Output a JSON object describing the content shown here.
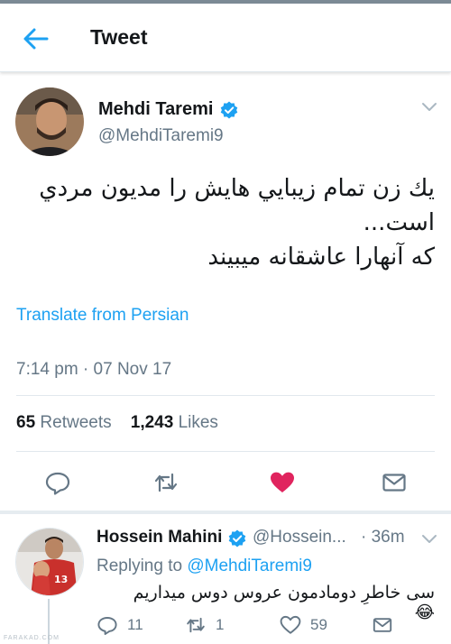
{
  "header": {
    "title": "Tweet",
    "back_icon": "arrow-left-icon"
  },
  "tweet": {
    "author_name": "Mehdi Taremi",
    "handle": "@MehdiTaremi9",
    "text_lines": [
      "يك زن تمام زيبايي هايش را مديون مردي",
      "است...",
      "كه آنهارا عاشقانه ميبيند"
    ],
    "translate_label": "Translate from Persian",
    "timestamp": "7:14 pm · 07 Nov 17",
    "retweets_count": "65",
    "retweets_label": "Retweets",
    "likes_count": "1,243",
    "likes_label": "Likes",
    "liked": true
  },
  "reply": {
    "author_name": "Hossein Mahini",
    "handle": "@Hossein...",
    "time": "· 36m",
    "replying_prefix": "Replying to",
    "replying_to": "@MehdiTaremi9",
    "text": "سی خاطرِ دومادمون عروس دوس میداریم😂",
    "reply_count": "11",
    "retweet_count": "1",
    "like_count": "59"
  },
  "watermark": "FARAKAD.COM",
  "colors": {
    "accent": "#1da1f2",
    "like": "#e0245e",
    "muted": "#657786",
    "text": "#14171a",
    "verified": "#1da1f2"
  }
}
